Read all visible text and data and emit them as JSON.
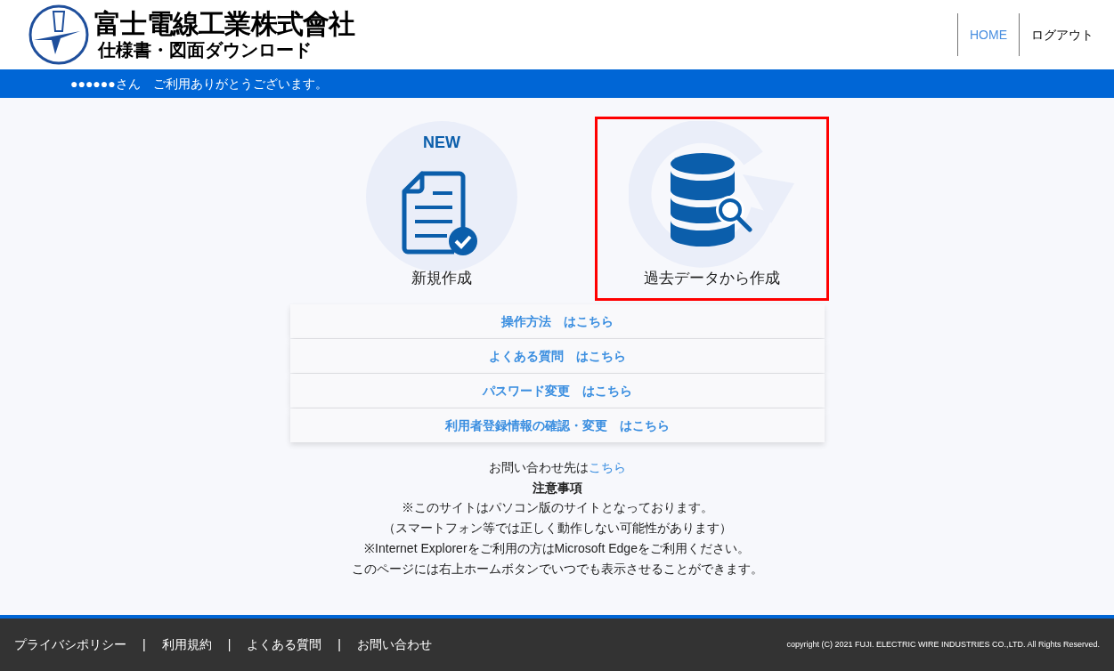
{
  "header": {
    "company_name": "富士電線工業株式會社",
    "site_title": "仕様書・図面ダウンロード",
    "nav": [
      {
        "label": "HOME",
        "selected": true
      },
      {
        "label": "ログアウト",
        "selected": false
      }
    ]
  },
  "welcome_bar": {
    "user": "●●●●●●さん",
    "message": "ご利用ありがとうございます。"
  },
  "tiles": [
    {
      "kind": "new",
      "badge": "NEW",
      "label": "新規作成",
      "selected": false
    },
    {
      "kind": "history",
      "label": "過去データから作成",
      "selected": true
    }
  ],
  "menu_links": [
    {
      "label": "操作方法",
      "link": "はこちら"
    },
    {
      "label": "よくある質問",
      "link": "はこちら"
    },
    {
      "label": "パスワード変更",
      "link": "はこちら"
    },
    {
      "label": "利用者登録情報の確認・変更",
      "link": "はこちら"
    }
  ],
  "contact": {
    "text": "お問い合わせ先は",
    "link": "こちら"
  },
  "notes": {
    "title": "注意事項",
    "lines": [
      "※このサイトはパソコン版のサイトとなっております。",
      "（スマートフォン等では正しく動作しない可能性があります）",
      "※Internet Explorerをご利用の方はMicrosoft Edgeをご利用ください。",
      "このページには右上ホームボタンでいつでも表示させることができます。"
    ]
  },
  "footer": {
    "items": [
      {
        "kind": "link",
        "label": "プライバシポリシー"
      },
      {
        "kind": "separator",
        "label": "|"
      },
      {
        "kind": "link",
        "label": "利用規約"
      },
      {
        "kind": "separator",
        "label": "|"
      },
      {
        "kind": "link",
        "label": "よくある質問"
      },
      {
        "kind": "separator",
        "label": "|"
      },
      {
        "kind": "link",
        "label": "お問い合わせ"
      }
    ],
    "copyright": "copyright (C) 2021 FUJI. ELECTRIC WIRE INDUSTRIES CO.,LTD. All Rights Reserved."
  }
}
